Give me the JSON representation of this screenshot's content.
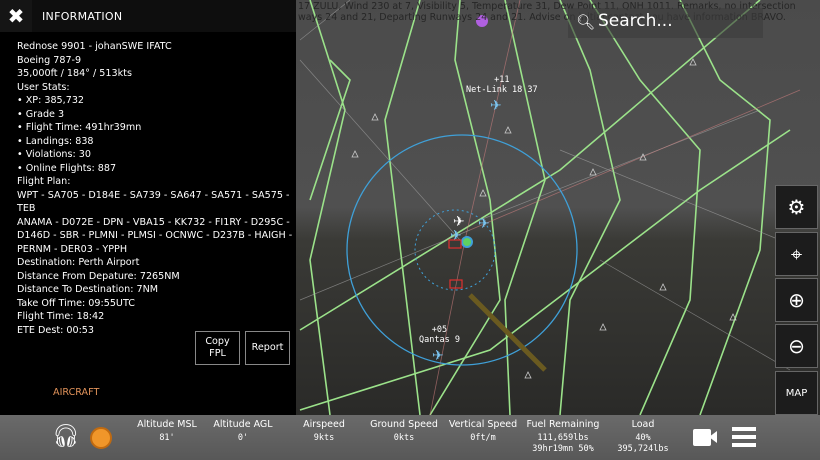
{
  "atis": {
    "line1": "17 ZULU, Wind 230 at 7, Visibility 5, Temperature 31, Dew Point 11, QNH 1011. Remarks, no intersection",
    "line2": "ways 24 and 21, Departing Runways 24 and 21. Advise on initial contact you have information BRAVO."
  },
  "search": {
    "placeholder": "Search..."
  },
  "map_labels": [
    {
      "alt": "+11",
      "name": "Net-Link 18 37"
    },
    {
      "alt": "+05",
      "name": "Qantas 9"
    }
  ],
  "panel": {
    "title": "INFORMATION",
    "lines": [
      "Rednose 9901 - johanSWE IFATC",
      "Boeing 787-9",
      "35,000ft / 184° / 513kts",
      "User Stats:",
      "• XP: 385,732",
      "•  Grade 3",
      "•  Flight Time: 491hr39mn",
      "•  Landings: 838",
      "• Violations: 30",
      "•  Online Flights: 887",
      "Flight Plan:",
      "WPT - SA705 - D184E - SA739 - SA647 - SA571 - SA575 - TEB",
      "ANAMA - D072E - DPN - VBA15 - KK732 - FI1RY - D295C -",
      "D146D - SBR - PLMNI - PLMSI - OCNWC - D237B - HAIGH -",
      "PERNM - DER03 - YPPH",
      "Destination: Perth Airport",
      "Distance From Depature: 7265NM",
      "Distance To Destination: 7NM",
      "Take Off Time: 09:55UTC",
      "Flight Time: 18:42",
      "ETE Dest: 00:53"
    ],
    "copy_fpl": "Copy FPL",
    "report": "Report",
    "aircraft_tab": "AIRCRAFT"
  },
  "right_buttons": {
    "map": "MAP"
  },
  "stats": [
    {
      "label": "Altitude MSL",
      "value": "81'",
      "value2": ""
    },
    {
      "label": "Altitude AGL",
      "value": "0'",
      "value2": ""
    },
    {
      "label": "Airspeed",
      "value": "9kts",
      "value2": ""
    },
    {
      "label": "Ground Speed",
      "value": "0kts",
      "value2": ""
    },
    {
      "label": "Vertical Speed",
      "value": "0ft/m",
      "value2": ""
    },
    {
      "label": "Fuel Remaining",
      "value": "111,659lbs",
      "value2": "39hr19mn 50%"
    },
    {
      "label": "Load",
      "value": "40%",
      "value2": "395,724lbs"
    }
  ],
  "colors": {
    "accent": "#f0962a",
    "sector": "#9be28a",
    "range_ring": "#3fa0d8",
    "aircraft": "#7ac4f0"
  }
}
